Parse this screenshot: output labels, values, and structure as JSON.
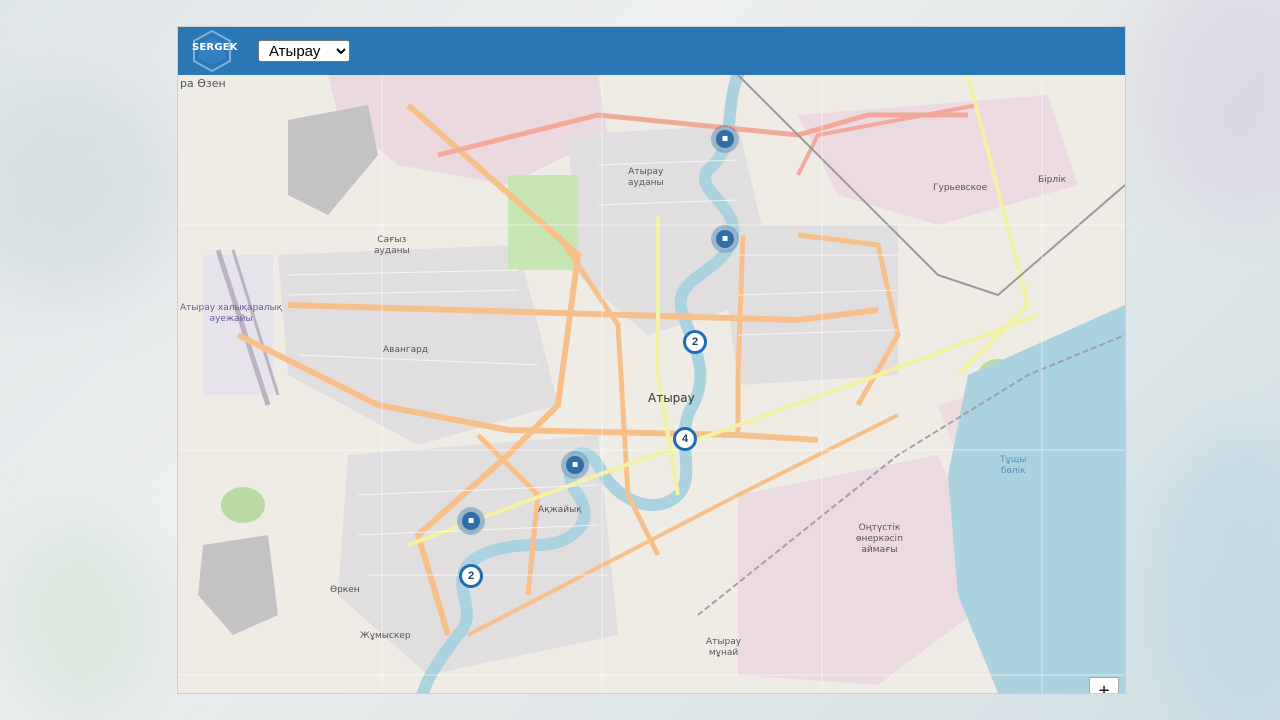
{
  "header": {
    "logo_text": "SERGEK",
    "city_select": {
      "selected": "Атырау",
      "options": [
        "Атырау"
      ]
    }
  },
  "map": {
    "labels": {
      "top_left": "ра Өзен",
      "pavlodar": "Сағыз\nауданы",
      "airport": "Атырау халықаралық\nәуежайы",
      "atyrau_district": "Атырау\nауданы",
      "center": "Атырау",
      "south": "Оңтүстік\nөнеркәсіп\nаймағы",
      "avangard": "Авангард",
      "zhumysker": "Жұмыскер",
      "birlik": "Бірлік",
      "yuryevsk": "Гурьевское",
      "atyrau_south": "Атырау\nмұнай",
      "orken": "Өркен",
      "akzhaiyk": "Ақжайық",
      "lake": "Тұщы\nбөлік"
    },
    "markers": [
      {
        "id": "m1",
        "kind": "camera",
        "glyph": "▪"
      },
      {
        "id": "m2",
        "kind": "camera",
        "glyph": "▪"
      },
      {
        "id": "m3",
        "kind": "camera",
        "glyph": "▪"
      },
      {
        "id": "m4",
        "kind": "camera",
        "glyph": "▪"
      }
    ],
    "clusters": [
      {
        "id": "c1",
        "count": "2"
      },
      {
        "id": "c2",
        "count": "4"
      },
      {
        "id": "c3",
        "count": "2"
      }
    ],
    "zoom": {
      "in_label": "+",
      "out_label": "−"
    }
  },
  "colors": {
    "header": "#2a77b4",
    "water": "#aad3df",
    "road_major": "#f7c08a",
    "road_secondary": "#f3f2a3",
    "park": "#c8e6b4",
    "industrial": "#ebd1e0",
    "marker": "#2f6ea7"
  }
}
